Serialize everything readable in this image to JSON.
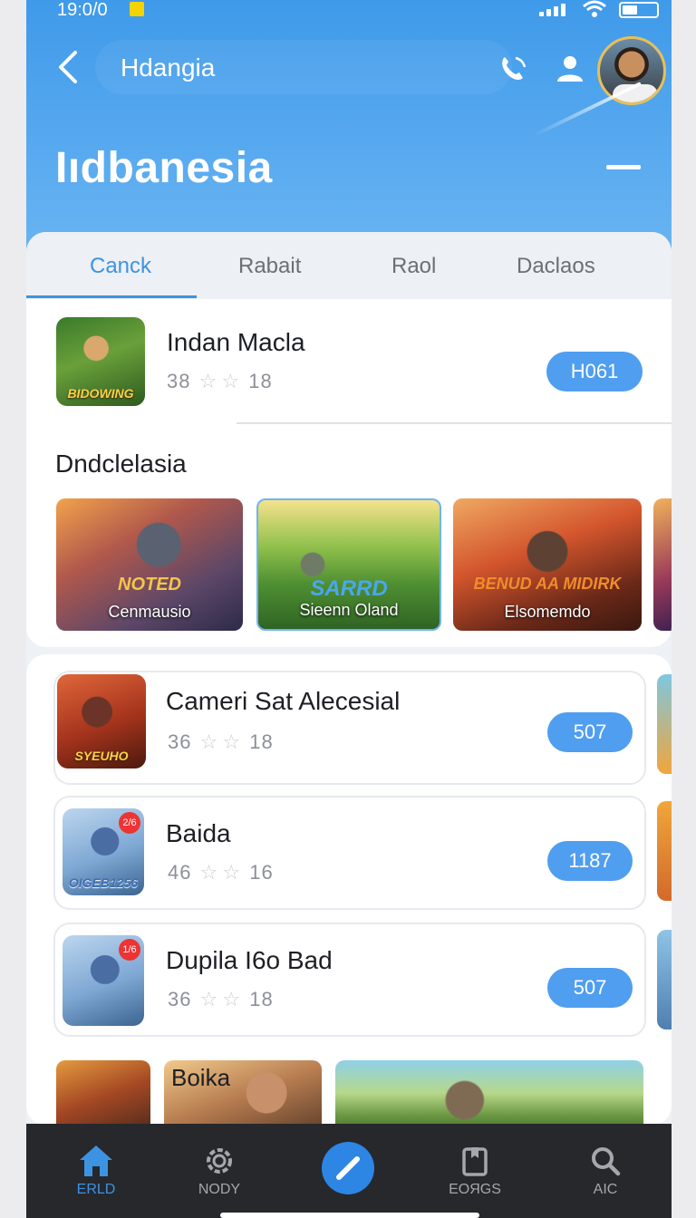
{
  "status_bar": {
    "time": "19:0/0"
  },
  "header": {
    "search_text": "Hdangia",
    "title": "Iıdbanesia"
  },
  "tabs": [
    {
      "label": "Canck",
      "active": true
    },
    {
      "label": "Rabait",
      "active": false
    },
    {
      "label": "Raol",
      "active": false
    },
    {
      "label": "Daclaos",
      "active": false
    }
  ],
  "featured": {
    "title": "Indan Macla",
    "rating": "38",
    "rating_count": "18",
    "icon_caption": "BIDOWING",
    "button_label": "H061"
  },
  "section": {
    "title": "Dndclelasia",
    "banners": [
      {
        "tag": "NOTED",
        "label": "Cenmausio"
      },
      {
        "tag": "SARRD",
        "label": "Sieenn Oland"
      },
      {
        "tag": "BENUD AA MIDIRK",
        "label": "Elsomemdo"
      }
    ]
  },
  "list": [
    {
      "title": "Cameri Sat Alecesial",
      "rating": "36",
      "rating_count": "18",
      "button_label": "507",
      "icon_caption": "SYEUHO"
    },
    {
      "title": "Baida",
      "rating": "46",
      "rating_count": "16",
      "button_label": "1187",
      "icon_caption": "OIGEB1256",
      "badge": "2/6"
    },
    {
      "title": "Dupila I6o Bad",
      "rating": "36",
      "rating_count": "18",
      "button_label": "507",
      "badge": "1/6"
    }
  ],
  "bottom_strip": {
    "label": "Boika"
  },
  "bottom_nav": [
    {
      "label": "ERLD",
      "icon": "home-icon",
      "active": true
    },
    {
      "label": "NODY",
      "icon": "gear-icon",
      "active": false
    },
    {
      "label": "EOЯGS",
      "icon": "bookmark-icon",
      "active": false
    },
    {
      "label": "AIC",
      "icon": "search-icon",
      "active": false
    }
  ],
  "colors": {
    "accent": "#3d93e2",
    "header": "#4fa3ee",
    "button": "#4f9ef0",
    "nav_bg": "#26282c"
  }
}
